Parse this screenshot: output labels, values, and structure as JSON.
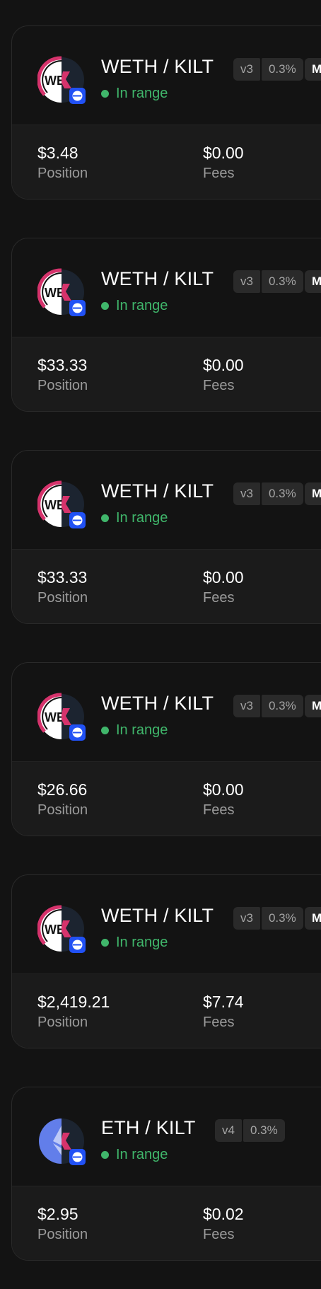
{
  "positions": [
    {
      "pair": "WETH / KILT",
      "version": "v3",
      "fee": "0.3%",
      "extra_badge": "M",
      "status": "In range",
      "position_value": "$3.48",
      "position_label": "Position",
      "fees_value": "$0.00",
      "fees_label": "Fees",
      "token0_icon": "weth-icon",
      "token1_icon": "kilt-icon",
      "network_icon": "base-network-icon"
    },
    {
      "pair": "WETH / KILT",
      "version": "v3",
      "fee": "0.3%",
      "extra_badge": "M",
      "status": "In range",
      "position_value": "$33.33",
      "position_label": "Position",
      "fees_value": "$0.00",
      "fees_label": "Fees",
      "token0_icon": "weth-icon",
      "token1_icon": "kilt-icon",
      "network_icon": "base-network-icon"
    },
    {
      "pair": "WETH / KILT",
      "version": "v3",
      "fee": "0.3%",
      "extra_badge": "M",
      "status": "In range",
      "position_value": "$33.33",
      "position_label": "Position",
      "fees_value": "$0.00",
      "fees_label": "Fees",
      "token0_icon": "weth-icon",
      "token1_icon": "kilt-icon",
      "network_icon": "base-network-icon"
    },
    {
      "pair": "WETH / KILT",
      "version": "v3",
      "fee": "0.3%",
      "extra_badge": "M",
      "status": "In range",
      "position_value": "$26.66",
      "position_label": "Position",
      "fees_value": "$0.00",
      "fees_label": "Fees",
      "token0_icon": "weth-icon",
      "token1_icon": "kilt-icon",
      "network_icon": "base-network-icon"
    },
    {
      "pair": "WETH / KILT",
      "version": "v3",
      "fee": "0.3%",
      "extra_badge": "M",
      "status": "In range",
      "position_value": "$2,419.21",
      "position_label": "Position",
      "fees_value": "$7.74",
      "fees_label": "Fees",
      "token0_icon": "weth-icon",
      "token1_icon": "kilt-icon",
      "network_icon": "base-network-icon"
    },
    {
      "pair": "ETH / KILT",
      "version": "v4",
      "fee": "0.3%",
      "extra_badge": "",
      "status": "In range",
      "position_value": "$2.95",
      "position_label": "Position",
      "fees_value": "$0.02",
      "fees_label": "Fees",
      "token0_icon": "eth-icon",
      "token1_icon": "kilt-icon",
      "network_icon": "base-network-icon"
    }
  ],
  "colors": {
    "background": "#131313",
    "card_bottom": "#1b1b1b",
    "in_range": "#40b66b",
    "kilt_accent": "#d6336c",
    "base_blue": "#2151f5",
    "eth_purple": "#627eea"
  }
}
